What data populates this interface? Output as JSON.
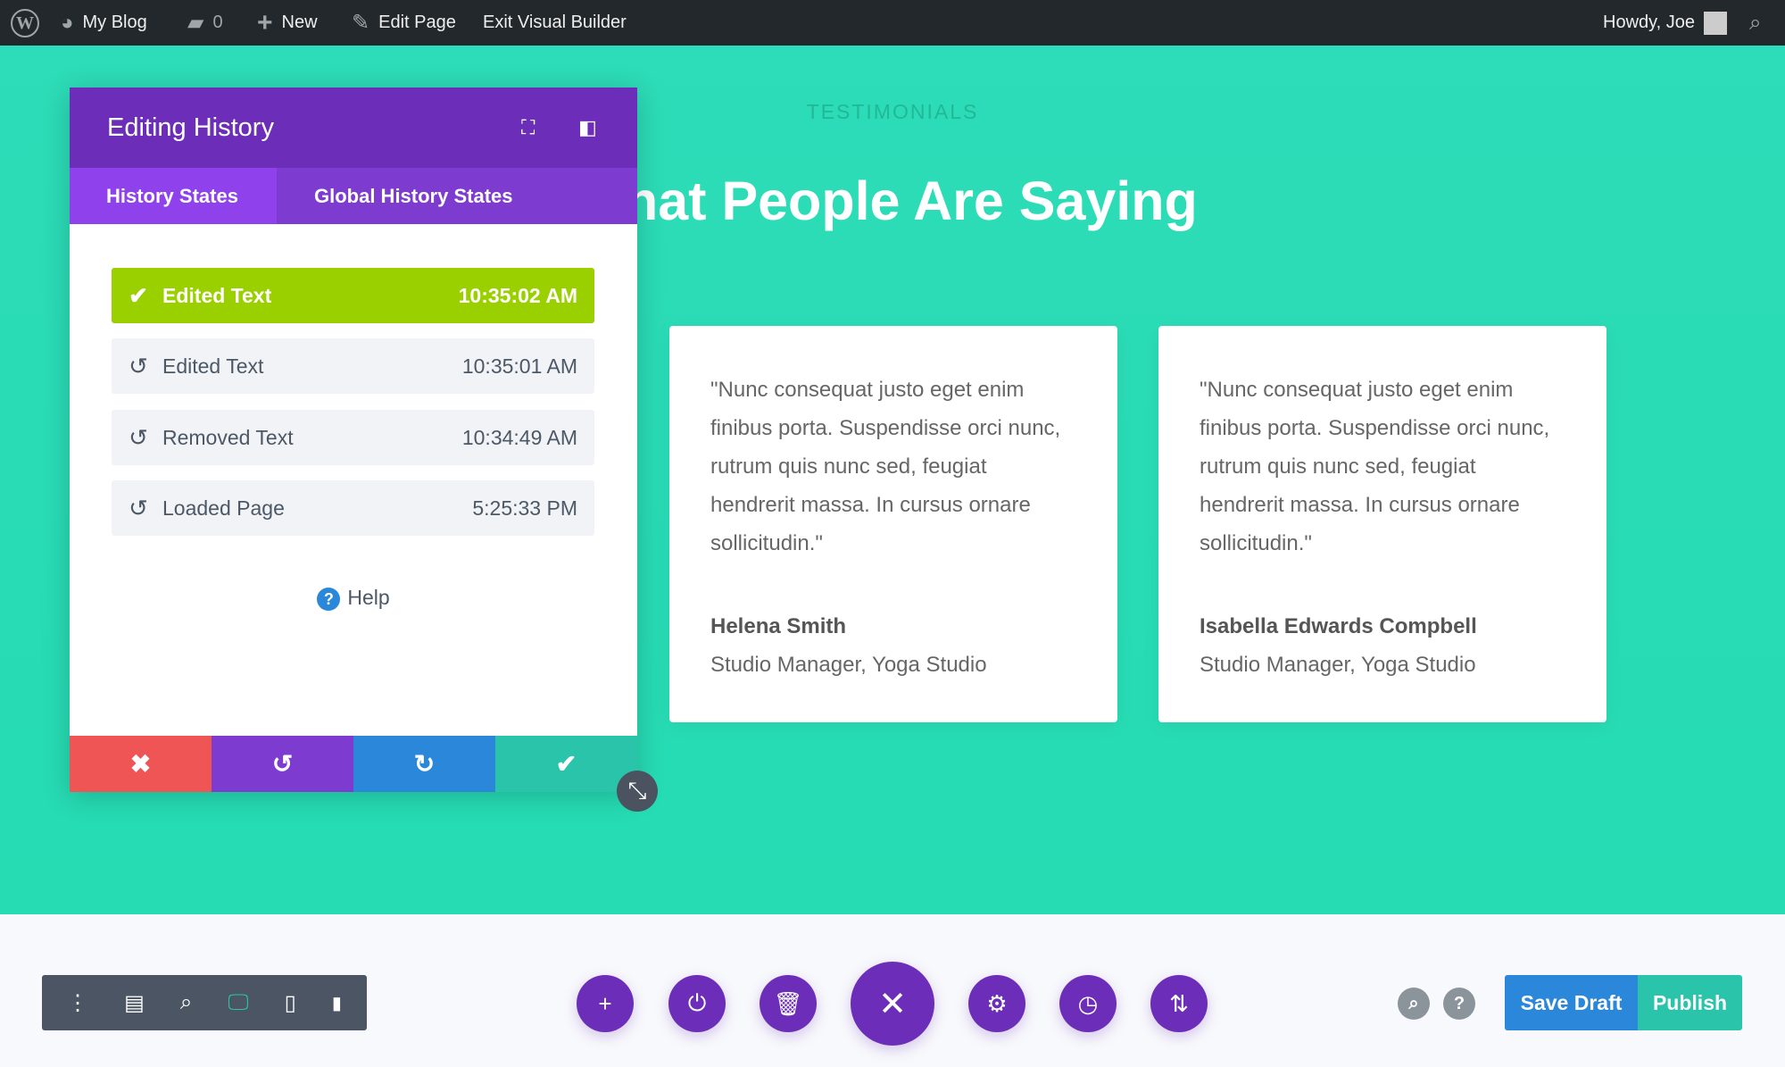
{
  "topbar": {
    "site": "My Blog",
    "comments": "0",
    "new": "New",
    "edit": "Edit Page",
    "exit": "Exit Visual Builder",
    "howdy": "Howdy, Joe"
  },
  "hero": {
    "eyebrow": "TESTIMONIALS",
    "heading": "hat People Are Saying"
  },
  "cards": [
    {
      "quote": "\"Nunc consequat justo eget enim finibus porta. Suspendisse orci nunc, rutrum quis nunc sed, feugiat hendrerit massa. In cursus ornare sollicitudin.\"",
      "name": "Helena Smith",
      "role": "Studio Manager, Yoga Studio"
    },
    {
      "quote": "\"Nunc consequat justo eget enim finibus porta. Suspendisse orci nunc, rutrum quis nunc sed, feugiat hendrerit massa. In cursus ornare sollicitudin.\"",
      "name": "Isabella Edwards Compbell",
      "role": "Studio Manager, Yoga Studio"
    }
  ],
  "panel": {
    "title": "Editing History",
    "tabs": [
      "History States",
      "Global History States"
    ],
    "states": [
      {
        "label": "Edited Text",
        "time": "10:35:02 AM",
        "current": true
      },
      {
        "label": "Edited Text",
        "time": "10:35:01 AM"
      },
      {
        "label": "Removed Text",
        "time": "10:34:49 AM"
      },
      {
        "label": "Loaded Page",
        "time": "5:25:33 PM"
      }
    ],
    "help": "Help",
    "colors": {
      "cancel": "#ef5555",
      "undo": "#7e3bd0",
      "redo": "#2b87da",
      "save": "#29c4a9"
    }
  },
  "footer": {
    "save_draft": "Save Draft",
    "publish": "Publish"
  },
  "colors": {
    "accent": "#6c2eb9",
    "hero": "#2ddcb8",
    "current_state": "#9bd000"
  }
}
